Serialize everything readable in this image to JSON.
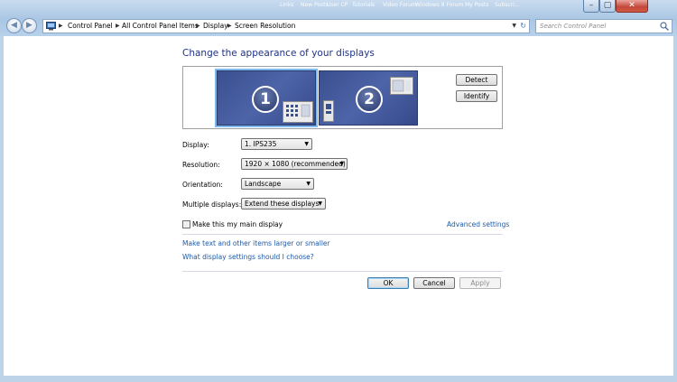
{
  "window": {
    "background_tabs": [
      "Links",
      "New Posts",
      "User CP",
      "Tutorials",
      "Video Forum",
      "Windows 8 Forum",
      "My Posts",
      "Subscri..."
    ]
  },
  "navbar": {
    "breadcrumbs": [
      "Control Panel",
      "All Control Panel Items",
      "Display",
      "Screen Resolution"
    ],
    "search_placeholder": "Search Control Panel"
  },
  "main": {
    "title": "Change the appearance of your displays",
    "monitors": [
      {
        "number": "1",
        "selected": true
      },
      {
        "number": "2",
        "selected": false
      }
    ],
    "detect_label": "Detect",
    "identify_label": "Identify",
    "display": {
      "label": "Display:",
      "value": "1. IPS235"
    },
    "resolution": {
      "label": "Resolution:",
      "value": "1920 × 1080 (recommended)"
    },
    "orientation": {
      "label": "Orientation:",
      "value": "Landscape"
    },
    "multiple_displays": {
      "label": "Multiple displays:",
      "value": "Extend these displays"
    },
    "main_display_checkbox": {
      "label": "Make this my main display",
      "checked": false
    },
    "advanced_settings": "Advanced settings",
    "links": [
      "Make text and other items larger or smaller",
      "What display settings should I choose?"
    ],
    "buttons": {
      "ok": "OK",
      "cancel": "Cancel",
      "apply": "Apply"
    }
  },
  "colors": {
    "accent": "#1e3287",
    "link": "#1e5aa8",
    "monitor": "#4d64a8",
    "selection": "#7fb8ee"
  }
}
